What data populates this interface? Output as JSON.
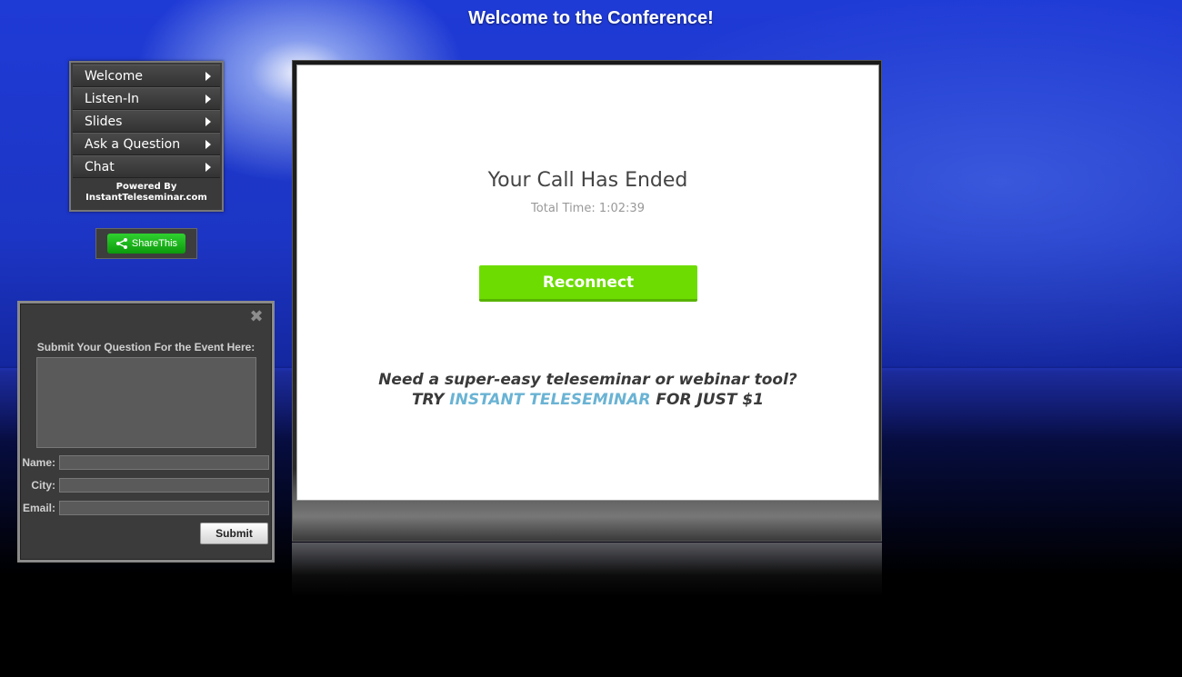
{
  "page_title": "Welcome to the Conference!",
  "nav": {
    "items": [
      {
        "label": "Welcome"
      },
      {
        "label": "Listen-In"
      },
      {
        "label": "Slides"
      },
      {
        "label": "Ask a Question"
      },
      {
        "label": "Chat"
      }
    ],
    "powered_by_line1": "Powered By",
    "powered_by_line2": "InstantTeleseminar.com"
  },
  "share": {
    "label": "ShareThis",
    "icon": "share-icon",
    "color": "#1db81d"
  },
  "question_form": {
    "close_icon": "close-icon",
    "heading": "Submit Your Question For the Event Here:",
    "question_value": "",
    "fields": [
      {
        "label": "Name:",
        "value": ""
      },
      {
        "label": "City:",
        "value": ""
      },
      {
        "label": "Email:",
        "value": ""
      }
    ],
    "submit_label": "Submit"
  },
  "call": {
    "title": "Your Call Has Ended",
    "total_time": "Total Time: 1:02:39",
    "reconnect_label": "Reconnect",
    "reconnect_color": "#6ddc00",
    "promo_line1": "Need a super-easy teleseminar or webinar tool?",
    "promo_try": "TRY",
    "promo_link": "INSTANT TELESEMINAR",
    "promo_tail": "FOR JUST $1",
    "link_color": "#6ab3d4"
  }
}
